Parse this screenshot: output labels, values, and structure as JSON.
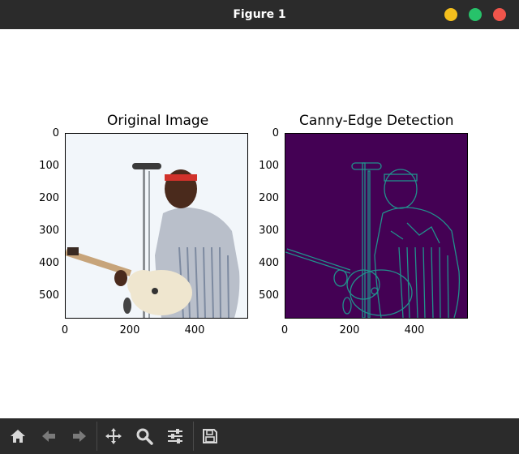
{
  "window": {
    "title": "Figure 1"
  },
  "chart_data": [
    {
      "type": "image",
      "title": "Original Image",
      "x_ticks": [
        "0",
        "200",
        "400"
      ],
      "y_ticks": [
        "0",
        "100",
        "200",
        "300",
        "400",
        "500"
      ],
      "xlim": [
        0,
        566
      ],
      "ylim": [
        573,
        0
      ]
    },
    {
      "type": "image",
      "title": "Canny-Edge Detection",
      "x_ticks": [
        "0",
        "200",
        "400"
      ],
      "y_ticks": [
        "0",
        "100",
        "200",
        "300",
        "400",
        "500"
      ],
      "xlim": [
        0,
        566
      ],
      "ylim": [
        573,
        0
      ],
      "colormap": "viridis"
    }
  ],
  "toolbar": {
    "buttons": [
      "home-icon",
      "back-arrow-icon",
      "forward-arrow-icon",
      "pan-icon",
      "zoom-icon",
      "configure-subplots-icon",
      "save-icon"
    ]
  },
  "colors": {
    "titlebar": "#2b2b2b",
    "edge_background": "#440154",
    "edge_line": "#21918c"
  }
}
